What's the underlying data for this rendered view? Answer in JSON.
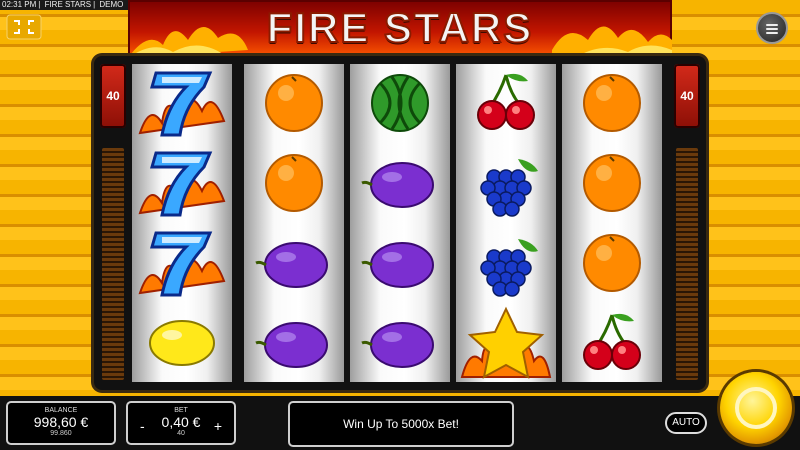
{
  "status_bar": {
    "time": "02:31 PM",
    "game_name": "FIRE STARS",
    "mode": "DEMO"
  },
  "header": {
    "title": "FIRE STARS"
  },
  "lines": {
    "left": "40",
    "right": "40"
  },
  "reels": [
    [
      "seven",
      "seven",
      "seven",
      "lemon"
    ],
    [
      "orange",
      "orange",
      "plum",
      "plum"
    ],
    [
      "watermelon",
      "plum",
      "plum",
      "plum"
    ],
    [
      "cherry",
      "grapes",
      "grapes",
      "star"
    ],
    [
      "orange",
      "orange",
      "orange",
      "cherry"
    ]
  ],
  "balance": {
    "label": "BALANCE",
    "value": "998,60 €",
    "credits": "99.860"
  },
  "bet": {
    "label": "BET",
    "value": "0,40 €",
    "minus": "-",
    "plus": "+",
    "lines": "40"
  },
  "message": "Win Up To 5000x Bet!",
  "controls": {
    "auto_label": "AUTO"
  },
  "icons": {
    "fullscreen": "fullscreen-icon",
    "menu": "hamburger-menu-icon",
    "spin": "spin-icon"
  },
  "colors": {
    "header_red": "#c21500",
    "background_gold": "#f7b400",
    "spin_gold": "#ffd400"
  }
}
